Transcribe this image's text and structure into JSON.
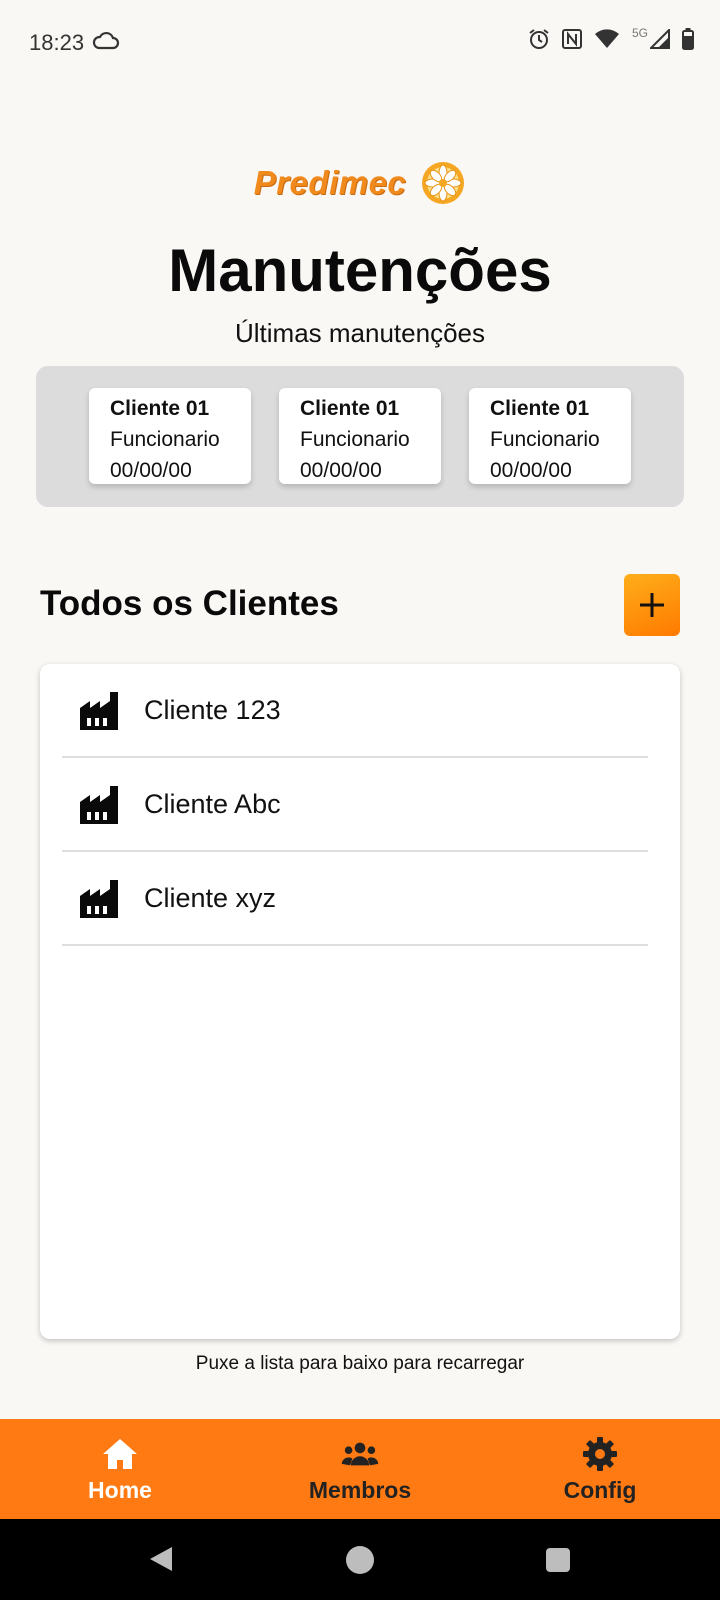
{
  "status_bar": {
    "time": "18:23",
    "network_label": "5G",
    "icons": [
      "cloud-icon",
      "alarm-icon",
      "nfc-icon",
      "wifi-icon",
      "signal-icon",
      "battery-icon"
    ]
  },
  "logo": {
    "text": "Predimec"
  },
  "header": {
    "title": "Manutenções",
    "subtitle": "Últimas manutenções"
  },
  "recent_maintenances": [
    {
      "client": "Cliente 01",
      "employee": "Funcionario",
      "date": "00/00/00"
    },
    {
      "client": "Cliente 01",
      "employee": "Funcionario",
      "date": "00/00/00"
    },
    {
      "client": "Cliente 01",
      "employee": "Funcionario",
      "date": "00/00/00"
    }
  ],
  "clients_section": {
    "title": "Todos os Clientes",
    "add_icon": "plus-icon",
    "items": [
      {
        "name": "Cliente 123",
        "icon": "factory-icon"
      },
      {
        "name": "Cliente Abc",
        "icon": "factory-icon"
      },
      {
        "name": "Cliente xyz",
        "icon": "factory-icon"
      }
    ],
    "pull_hint": "Puxe a lista para baixo para recarregar"
  },
  "bottom_nav": [
    {
      "label": "Home",
      "icon": "home-icon",
      "active": true
    },
    {
      "label": "Membros",
      "icon": "users-icon",
      "active": false
    },
    {
      "label": "Config",
      "icon": "gear-icon",
      "active": false
    }
  ],
  "colors": {
    "accent": "#ff7a12",
    "logo": "#f08a1c",
    "background": "#faf8f5",
    "panel": "#dcdcdc"
  }
}
